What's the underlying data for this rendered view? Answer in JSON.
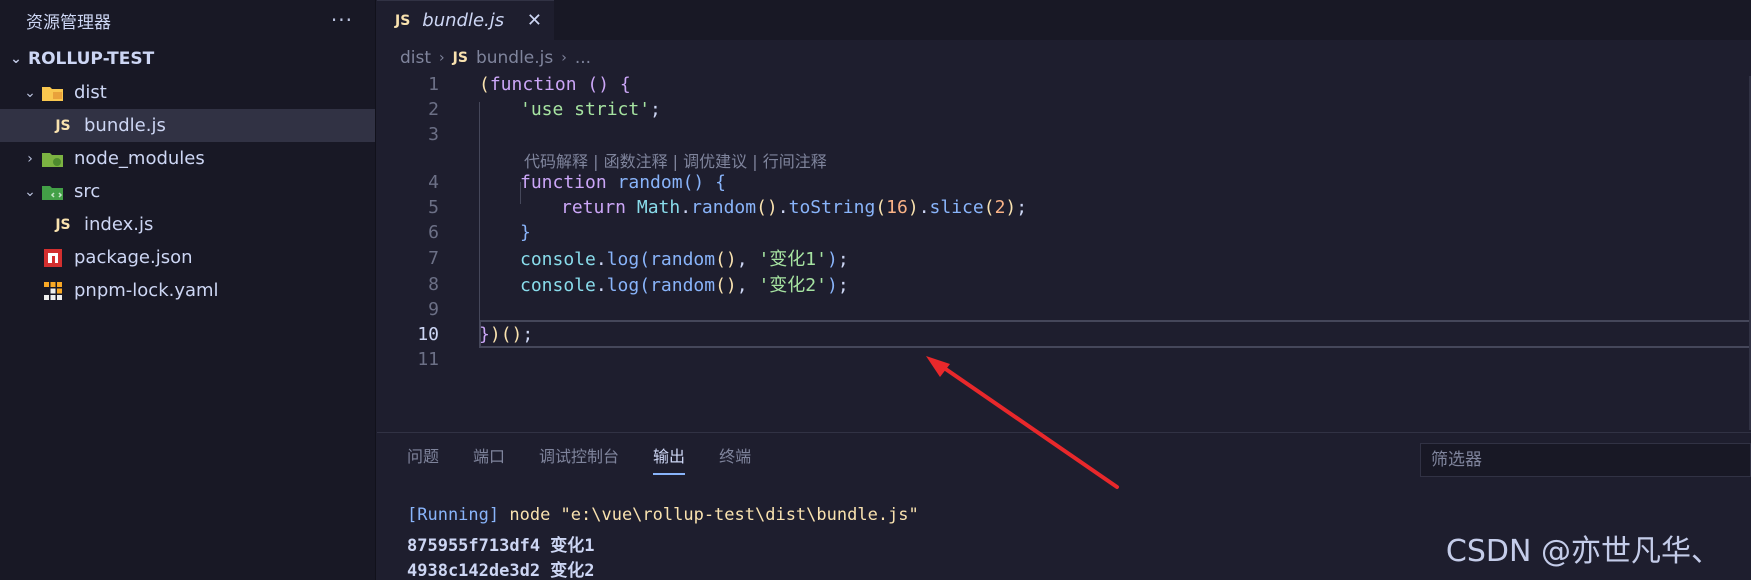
{
  "sidebar": {
    "title": "资源管理器",
    "more_icon": "more-actions-icon",
    "project": "ROLLUP-TEST",
    "tree": [
      {
        "label": "dist",
        "kind": "folder",
        "expanded": true,
        "depth": 1,
        "icon": "folder-dist-icon"
      },
      {
        "label": "bundle.js",
        "kind": "file",
        "depth": 2,
        "icon": "js-file-icon",
        "selected": true
      },
      {
        "label": "node_modules",
        "kind": "folder",
        "expanded": false,
        "depth": 1,
        "icon": "folder-node-icon"
      },
      {
        "label": "src",
        "kind": "folder",
        "expanded": true,
        "depth": 1,
        "icon": "folder-src-icon"
      },
      {
        "label": "index.js",
        "kind": "file",
        "depth": 2,
        "icon": "js-file-icon"
      },
      {
        "label": "package.json",
        "kind": "file",
        "depth": 1,
        "icon": "npm-icon"
      },
      {
        "label": "pnpm-lock.yaml",
        "kind": "file",
        "depth": 1,
        "icon": "pnpm-icon"
      }
    ]
  },
  "tab": {
    "badge": "JS",
    "title": "bundle.js",
    "close_icon": "close-icon"
  },
  "breadcrumb": {
    "items": [
      "dist",
      "bundle.js",
      "..."
    ],
    "badge": "JS"
  },
  "editor": {
    "active_line": 10,
    "codelens": "代码解释 | 函数注释 | 调优建议 | 行间注释",
    "lines": [
      {
        "n": "1"
      },
      {
        "n": "2"
      },
      {
        "n": "3"
      },
      {
        "n": "4"
      },
      {
        "n": "5"
      },
      {
        "n": "6"
      },
      {
        "n": "7"
      },
      {
        "n": "8"
      },
      {
        "n": "9"
      },
      {
        "n": "10"
      },
      {
        "n": "11"
      }
    ],
    "tokens": {
      "l1_open": "(",
      "l1_kw": "function",
      "l1_parens": " ()",
      "l1_brace": " {",
      "l2_str": "'use strict'",
      "l2_semi": ";",
      "l4_kw": "function",
      "l4_fn": " random",
      "l4_parens": "()",
      "l4_brace": " {",
      "l5_kw": "return",
      "l5_obj": " Math",
      "l5_dot1": ".",
      "l5_fn1": "random",
      "l5_p1": "()",
      "l5_dot2": ".",
      "l5_fn2": "toString",
      "l5_po": "(",
      "l5_num1": "16",
      "l5_pc": ")",
      "l5_dot3": ".",
      "l5_fn3": "slice",
      "l5_po2": "(",
      "l5_num2": "2",
      "l5_pc2": ")",
      "l5_semi": ";",
      "l6_brace": "}",
      "l7_obj": "console",
      "l7_dot": ".",
      "l7_fn": "log",
      "l7_po": "(",
      "l7_fn2": "random",
      "l7_pp": "()",
      "l7_comma": ", ",
      "l7_str": "'变化1'",
      "l7_pc": ")",
      "l7_semi": ";",
      "l8_obj": "console",
      "l8_dot": ".",
      "l8_fn": "log",
      "l8_po": "(",
      "l8_fn2": "random",
      "l8_pp": "()",
      "l8_comma": ", ",
      "l8_str": "'变化2'",
      "l8_pc": ")",
      "l8_semi": ";",
      "l10_brace": "}",
      "l10_pc": ")",
      "l10_pp": "()",
      "l10_semi": ";"
    }
  },
  "panel": {
    "tabs": [
      "问题",
      "端口",
      "调试控制台",
      "输出",
      "终端"
    ],
    "active_tab": "输出",
    "filter_placeholder": "筛选器",
    "output": {
      "running_tag": "[Running]",
      "command": " node \"e:\\vue\\rollup-test\\dist\\bundle.js\"",
      "lines": [
        "875955f713df4 变化1",
        "4938c142de3d2 变化2"
      ]
    }
  },
  "watermark": "CSDN @亦世凡华、",
  "annotation": {
    "color": "#e8282b",
    "icon": "red-arrow-annotation"
  }
}
